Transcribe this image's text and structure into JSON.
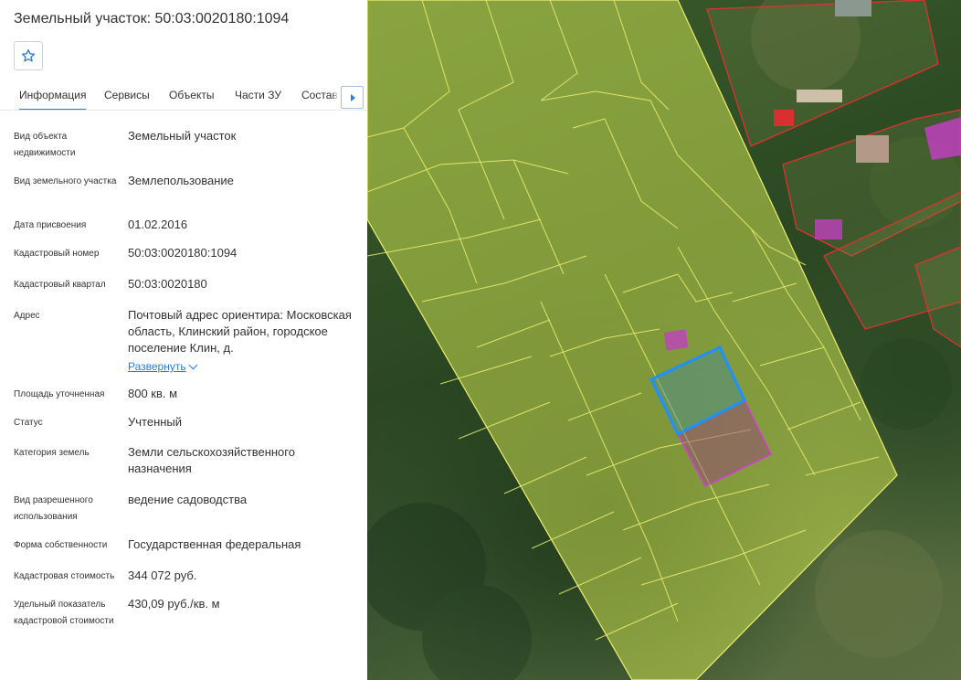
{
  "panel": {
    "title": "Земельный участок: 50:03:0020180:1094",
    "favorite_icon": "star-icon",
    "tabs": [
      {
        "label": "Информация",
        "active": true
      },
      {
        "label": "Сервисы"
      },
      {
        "label": "Объекты"
      },
      {
        "label": "Части ЗУ"
      },
      {
        "label": "Состав ЕЗП"
      }
    ],
    "scroll_icon": "caret-right-icon",
    "fields": [
      {
        "label": "Вид объекта недвижимости",
        "value": "Земельный участок"
      },
      {
        "label": "Вид земельного участка",
        "value": "Землепользование"
      },
      {
        "label": "Дата присвоения",
        "value": "01.02.2016"
      },
      {
        "label": "Кадастровый номер",
        "value": "50:03:0020180:1094"
      },
      {
        "label": "Кадастровый квартал",
        "value": "50:03:0020180"
      },
      {
        "label": "Адрес",
        "value": "Почтовый адрес ориентира: Московская область, Клинский район, городское поселение Клин, д."
      },
      {
        "label": "Площадь уточненная",
        "value": "800 кв. м"
      },
      {
        "label": "Статус",
        "value": "Учтенный"
      },
      {
        "label": "Категория земель",
        "value": "Земли сельскохозяйственного назначения"
      },
      {
        "label": "Вид разрешенного использования",
        "value": "ведение садоводства"
      },
      {
        "label": "Форма собственности",
        "value": "Государственная федеральная"
      },
      {
        "label": "Кадастровая стоимость",
        "value": "344 072 руб."
      },
      {
        "label": "Удельный показатель кадастровой стоимости",
        "value": "430,09 руб./кв. м"
      }
    ],
    "expand_label": "Развернуть"
  },
  "map": {
    "colors": {
      "parcel_fill": "#d8e65a",
      "parcel_border": "#f0f070",
      "selected_border": "#1e90ff",
      "building_fill": "#c040c0",
      "settlement_border": "#e03030"
    }
  }
}
